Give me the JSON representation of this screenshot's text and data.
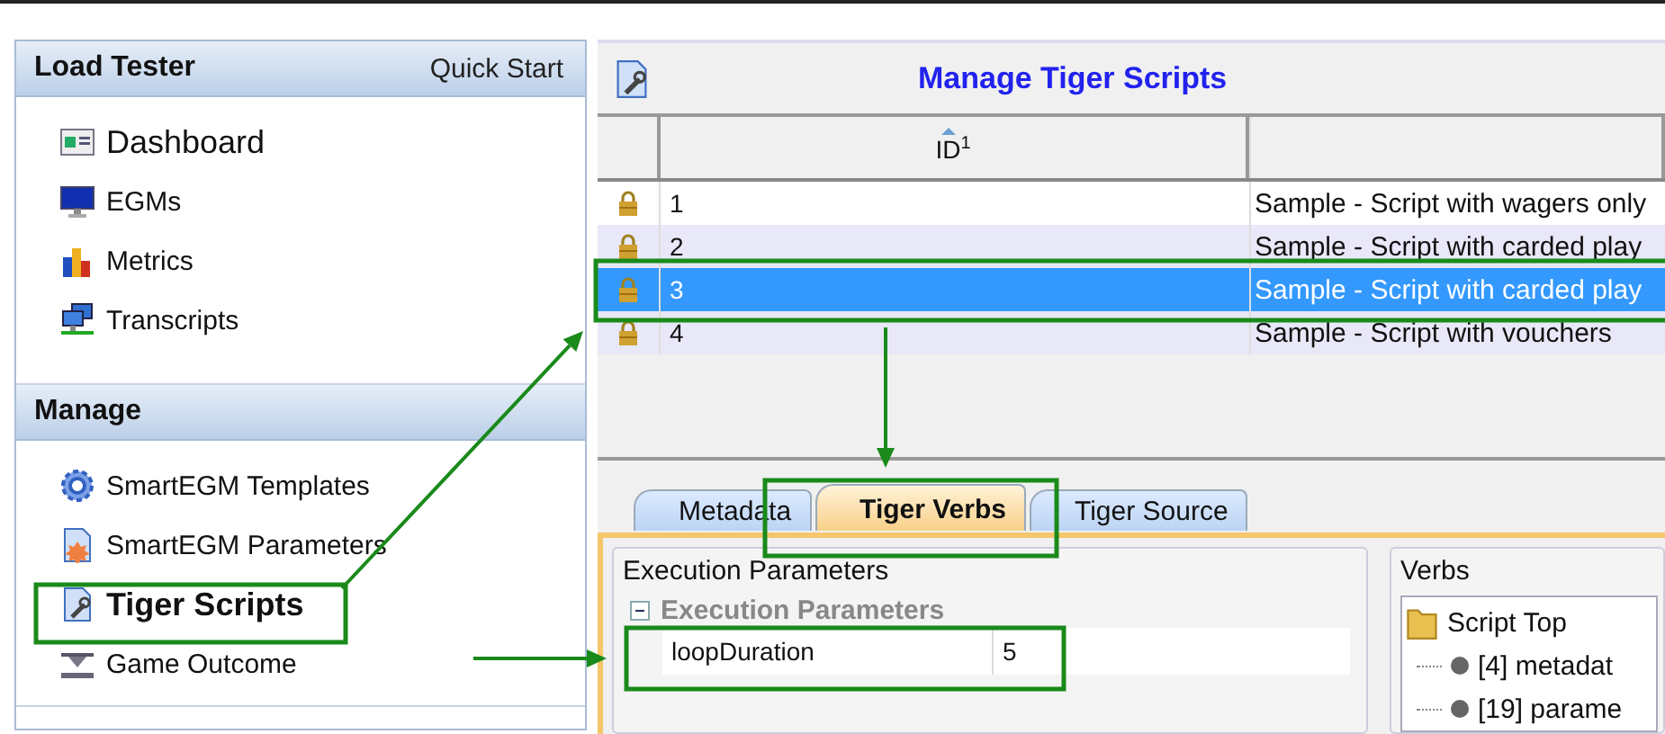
{
  "sidebar": {
    "sections": [
      {
        "title": "Load Tester",
        "action": "Quick Start",
        "items": [
          {
            "label": "Dashboard",
            "selected": false,
            "large": true
          },
          {
            "label": "EGMs",
            "selected": false,
            "large": false
          },
          {
            "label": "Metrics",
            "selected": false,
            "large": false
          },
          {
            "label": "Transcripts",
            "selected": false,
            "large": false
          }
        ]
      },
      {
        "title": "Manage",
        "items": [
          {
            "label": "SmartEGM Templates",
            "selected": false,
            "large": false
          },
          {
            "label": "SmartEGM Parameters",
            "selected": false,
            "large": false
          },
          {
            "label": "Tiger Scripts",
            "selected": true,
            "large": false
          },
          {
            "label": "Game Outcome",
            "selected": false,
            "large": false
          }
        ]
      }
    ]
  },
  "main": {
    "title": "Manage Tiger Scripts",
    "table": {
      "columns": [
        {
          "label": "ID",
          "sort_rank": "1"
        }
      ],
      "rows": [
        {
          "id": "1",
          "description": "Sample - Script with wagers only",
          "locked": true,
          "selected": false
        },
        {
          "id": "2",
          "description": "Sample - Script with carded play",
          "locked": true,
          "selected": false
        },
        {
          "id": "3",
          "description": "Sample - Script with carded play",
          "locked": true,
          "selected": true
        },
        {
          "id": "4",
          "description": "Sample - Script with vouchers",
          "locked": true,
          "selected": false
        }
      ]
    },
    "tabs": [
      {
        "label": "Metadata",
        "selected": false
      },
      {
        "label": "Tiger Verbs",
        "selected": true
      },
      {
        "label": "Tiger Source",
        "selected": false
      }
    ],
    "execution_parameters": {
      "title": "Execution Parameters",
      "category": "Execution Parameters",
      "expanded": true,
      "rows": [
        {
          "name": "loopDuration",
          "value": "5"
        }
      ]
    },
    "verbs": {
      "title": "Verbs",
      "tree": [
        {
          "label": "Script Top",
          "children": [
            {
              "label": "[4] metadat"
            },
            {
              "label": "[19] parame"
            }
          ]
        }
      ]
    }
  }
}
